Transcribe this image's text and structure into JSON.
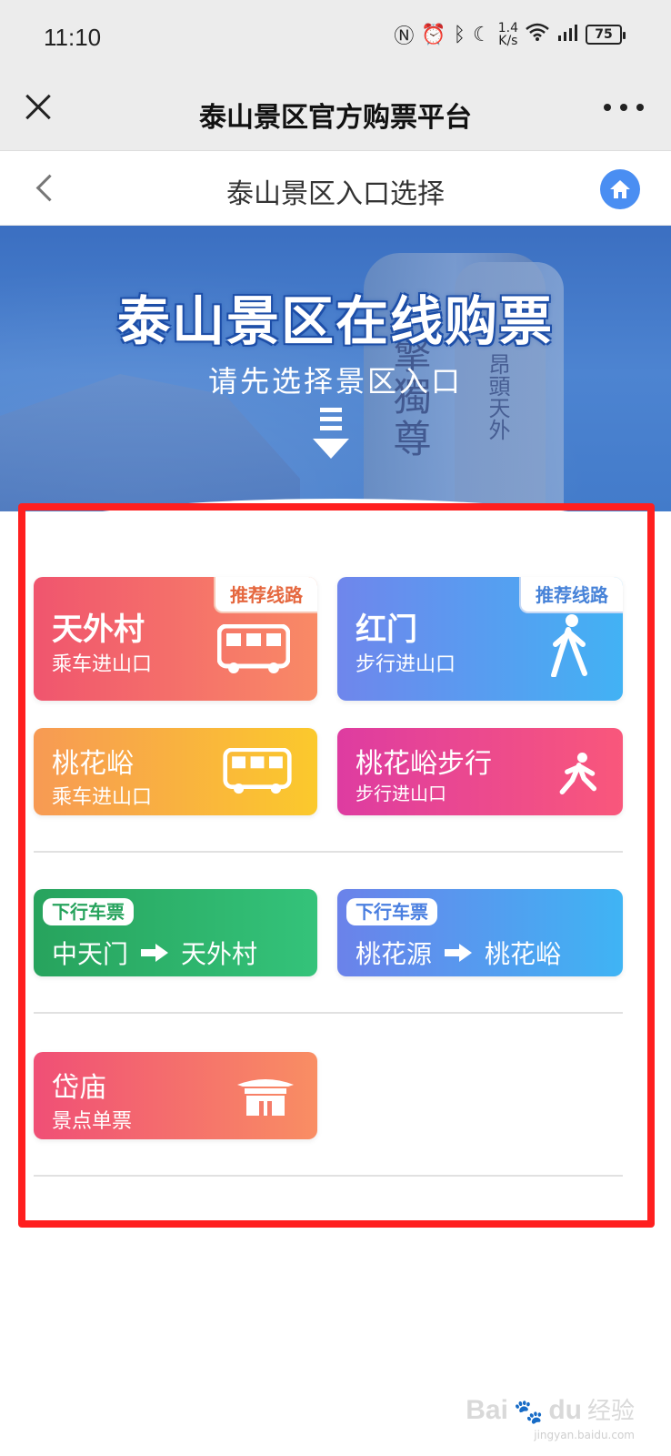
{
  "status_bar": {
    "time": "11:10",
    "net_speed_value": "1.4",
    "net_speed_unit": "K/s",
    "battery": "75"
  },
  "app_bar": {
    "title": "泰山景区官方购票平台"
  },
  "sub_nav": {
    "title": "泰山景区入口选择"
  },
  "banner": {
    "title": "泰山景区在线购票",
    "subtitle": "请先选择景区入口",
    "carving_main": "擎獨尊",
    "carving_side": "昂頭天外"
  },
  "entrances": [
    {
      "name": "天外村",
      "desc": "乘车进山口",
      "tag": "推荐线路",
      "icon": "bus-icon",
      "colors": [
        "#f0556e",
        "#f98a66"
      ]
    },
    {
      "name": "红门",
      "desc": "步行进山口",
      "tag": "推荐线路",
      "icon": "walking-person-icon",
      "colors": [
        "#6f86ec",
        "#42b2f4"
      ]
    },
    {
      "name": "桃花峪",
      "desc": "乘车进山口",
      "icon": "bus-icon",
      "colors": [
        "#f79a54",
        "#fbc92c"
      ]
    },
    {
      "name": "桃花峪步行",
      "desc": "步行进山口",
      "icon": "walking-person-icon",
      "colors": [
        "#de3ca1",
        "#f9577b"
      ]
    }
  ],
  "downhill": [
    {
      "tag": "下行车票",
      "from": "中天门",
      "to": "天外村",
      "colors": [
        "#27a35d",
        "#34c37a"
      ]
    },
    {
      "tag": "下行车票",
      "from": "桃花源",
      "to": "桃花峪",
      "colors": [
        "#6b82ea",
        "#3fb4f4"
      ]
    }
  ],
  "attractions": [
    {
      "name": "岱庙",
      "desc": "景点单票",
      "icon": "temple-icon"
    }
  ],
  "watermark": {
    "main": "Bai",
    "main2": "du",
    "cn": "经验",
    "url": "jingyan.baidu.com"
  }
}
